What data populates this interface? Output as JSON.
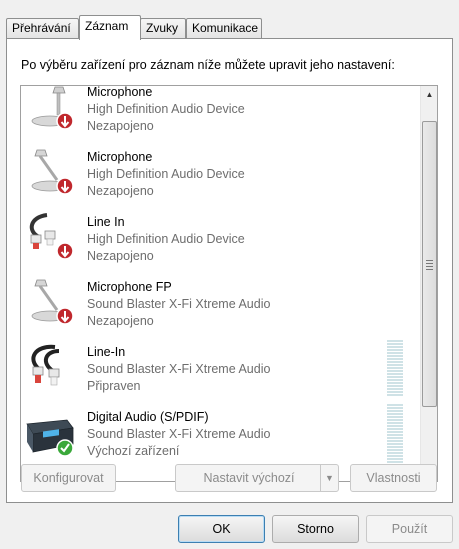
{
  "tabs": [
    {
      "label": "Přehrávání",
      "active": false
    },
    {
      "label": "Záznam",
      "active": true
    },
    {
      "label": "Zvuky",
      "active": false
    },
    {
      "label": "Komunikace",
      "active": false
    }
  ],
  "instruction": "Po výběru zařízení pro záznam níže můžete upravit jeho nastavení:",
  "devices": [
    {
      "name": "Microphone",
      "driver": "High Definition Audio Device",
      "status": "Nezapojeno",
      "icon": "microphone-icon"
    },
    {
      "name": "Microphone",
      "driver": "High Definition Audio Device",
      "status": "Nezapojeno",
      "icon": "microphone-icon"
    },
    {
      "name": "Line In",
      "driver": "High Definition Audio Device",
      "status": "Nezapojeno",
      "icon": "line-in-cable-icon"
    },
    {
      "name": "Microphone FP",
      "driver": "Sound Blaster X-Fi Xtreme Audio",
      "status": "Nezapojeno",
      "icon": "microphone-icon"
    },
    {
      "name": "Line-In",
      "driver": "Sound Blaster X-Fi Xtreme Audio",
      "status": "Připraven",
      "icon": "line-in-cable-icon"
    },
    {
      "name": "Digital Audio (S/PDIF)",
      "driver": "Sound Blaster X-Fi Xtreme Audio",
      "status": "Výchozí zařízení",
      "icon": "digital-audio-device-icon"
    }
  ],
  "buttons": {
    "configure": "Konfigurovat",
    "set_default": "Nastavit výchozí",
    "properties": "Vlastnosti",
    "ok": "OK",
    "cancel": "Storno",
    "apply": "Použít"
  },
  "colors": {
    "disconnected_badge": "#c0282d",
    "default_badge": "#3aa83a",
    "meter_idle": "#cfe2e6"
  }
}
